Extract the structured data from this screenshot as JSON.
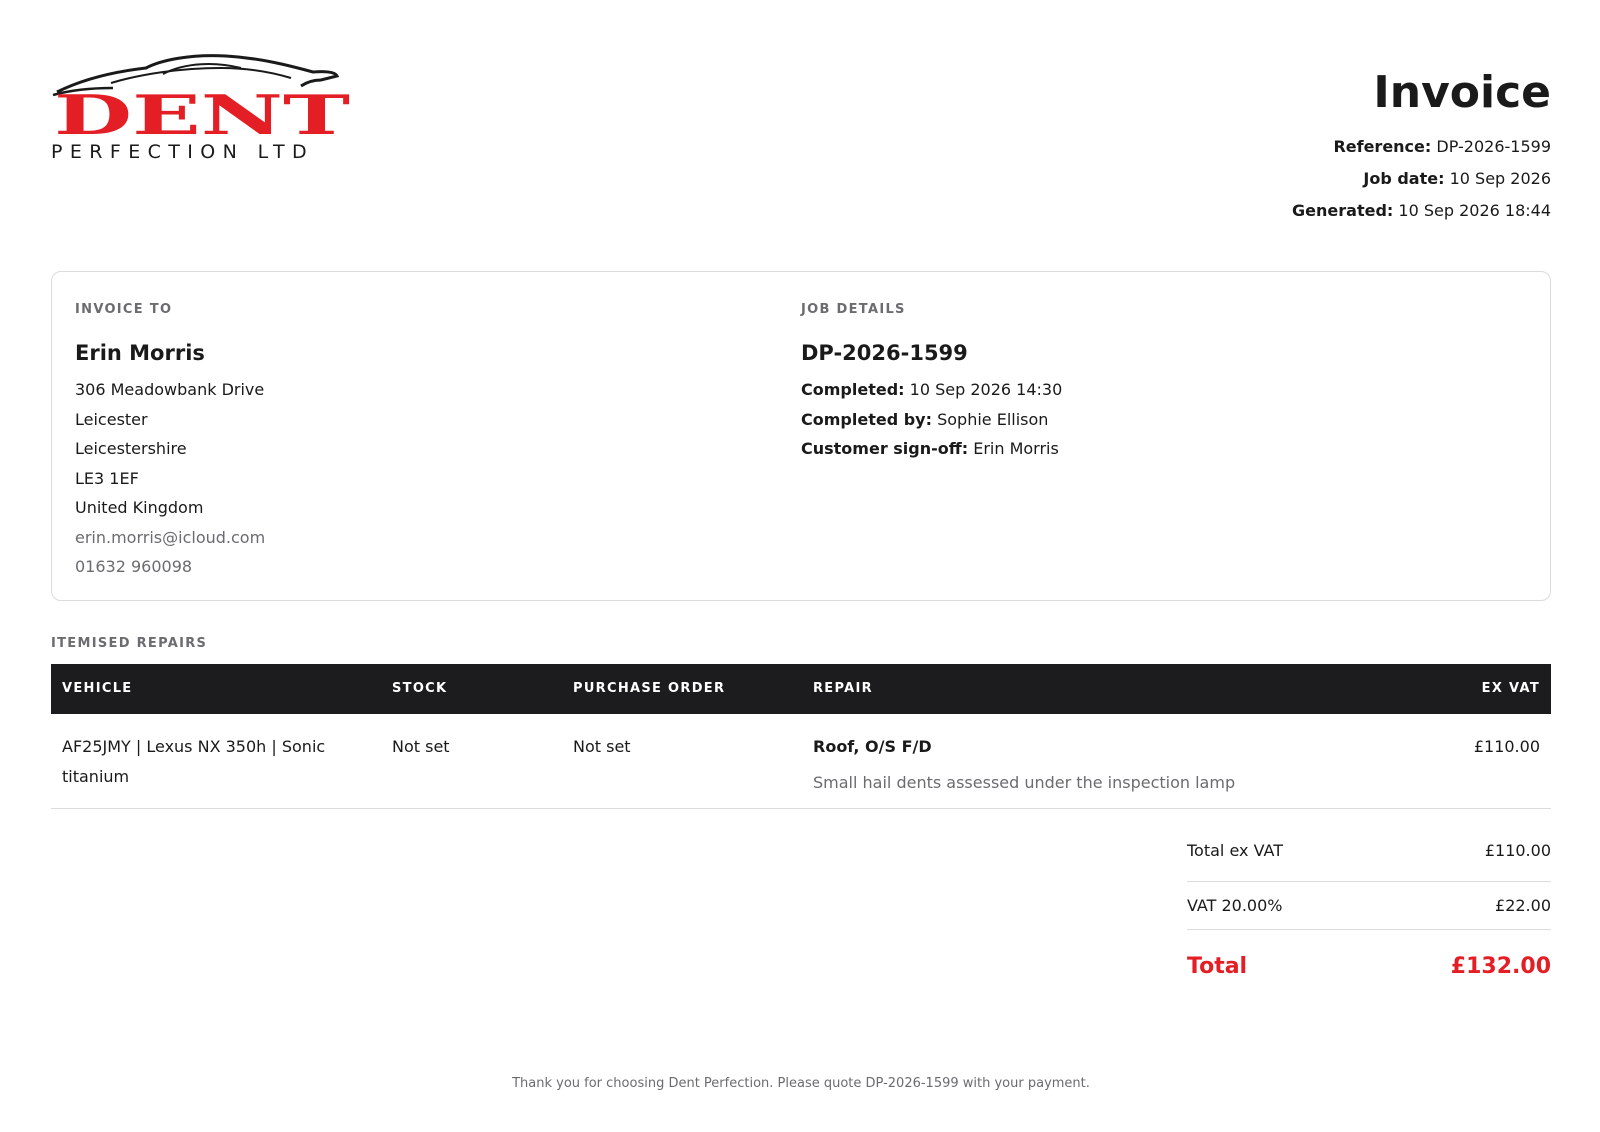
{
  "brand": {
    "logo_word": "DENT",
    "logo_tagline": "PERFECTION LTD",
    "accent_color": "#e31e24"
  },
  "header": {
    "title": "Invoice",
    "reference_label": "Reference:",
    "reference_value": "DP-2026-1599",
    "job_date_label": "Job date:",
    "job_date_value": "10 Sep 2026",
    "generated_label": "Generated:",
    "generated_value": "10 Sep 2026 18:44"
  },
  "invoice_to": {
    "label": "INVOICE TO",
    "name": "Erin Morris",
    "address": [
      "306 Meadowbank Drive",
      "Leicester",
      "Leicestershire",
      "LE3 1EF",
      "United Kingdom"
    ],
    "email": "erin.morris@icloud.com",
    "phone": "01632 960098"
  },
  "job_details": {
    "label": "JOB DETAILS",
    "reference": "DP-2026-1599",
    "completed_label": "Completed:",
    "completed_value": "10 Sep 2026 14:30",
    "completed_by_label": "Completed by:",
    "completed_by_value": "Sophie Ellison",
    "signoff_label": "Customer sign-off:",
    "signoff_value": "Erin Morris"
  },
  "items": {
    "section_label": "ITEMISED REPAIRS",
    "columns": [
      "VEHICLE",
      "STOCK",
      "PURCHASE ORDER",
      "REPAIR",
      "EX VAT"
    ],
    "rows": [
      {
        "vehicle_line1": "AF25JMY | Lexus NX 350h | Sonic",
        "vehicle_line2": "titanium",
        "stock": "Not set",
        "purchase_order": "Not set",
        "repair_title": "Roof, O/S F/D",
        "repair_desc": "Small hail dents assessed under the inspection lamp",
        "ex_vat": "£110.00"
      }
    ]
  },
  "totals": {
    "ex_vat_label": "Total ex VAT",
    "ex_vat_value": "£110.00",
    "vat_label": "VAT 20.00%",
    "vat_value": "£22.00",
    "total_label": "Total",
    "total_value": "£132.00"
  },
  "footer": {
    "text": "Thank you for choosing Dent Perfection. Please quote DP-2026-1599 with your payment."
  }
}
